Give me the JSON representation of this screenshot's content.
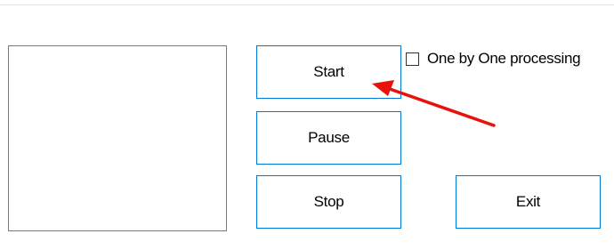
{
  "buttons": {
    "start": "Start",
    "pause": "Pause",
    "stop": "Stop",
    "exit": "Exit"
  },
  "checkbox": {
    "label": "One by One processing",
    "checked": false
  },
  "colors": {
    "button_border": "#0078d7",
    "annotation_arrow": "#e8120c",
    "preview_border": "#7a7a7a"
  }
}
